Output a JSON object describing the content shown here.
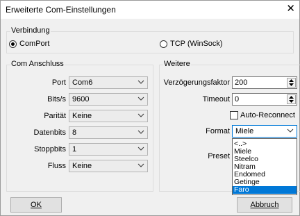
{
  "window": {
    "title": "Erweiterte Com-Einstellungen",
    "close_glyph": "✕"
  },
  "verbindung": {
    "label": "Verbindung",
    "options": [
      {
        "label": "ComPort",
        "selected": true
      },
      {
        "label": "TCP (WinSock)",
        "selected": false
      }
    ]
  },
  "com_anschluss": {
    "label": "Com Anschluss",
    "fields": [
      {
        "label": "Port",
        "value": "Com6"
      },
      {
        "label": "Bits/s",
        "value": "9600"
      },
      {
        "label": "Parität",
        "value": "Keine"
      },
      {
        "label": "Datenbits",
        "value": "8"
      },
      {
        "label": "Stoppbits",
        "value": "1"
      },
      {
        "label": "Fluss",
        "value": "Keine"
      }
    ]
  },
  "weitere": {
    "label": "Weitere",
    "verzoegerung_label": "Verzögerungsfaktor",
    "verzoegerung_value": "200",
    "timeout_label": "Timeout",
    "timeout_value": "0",
    "auto_reconnect_label": "Auto-Reconnect",
    "auto_reconnect_checked": false,
    "format_label": "Format",
    "format_value": "Miele",
    "preset_label": "Preset",
    "format_options": [
      "<..>",
      "Miele",
      "Steelco",
      "Nitram",
      "Endomed",
      "Getinge",
      "Faro"
    ],
    "format_highlighted": "Faro"
  },
  "buttons": {
    "ok": "OK",
    "abbruch": "Abbruch"
  },
  "colors": {
    "highlight": "#0078d7"
  }
}
